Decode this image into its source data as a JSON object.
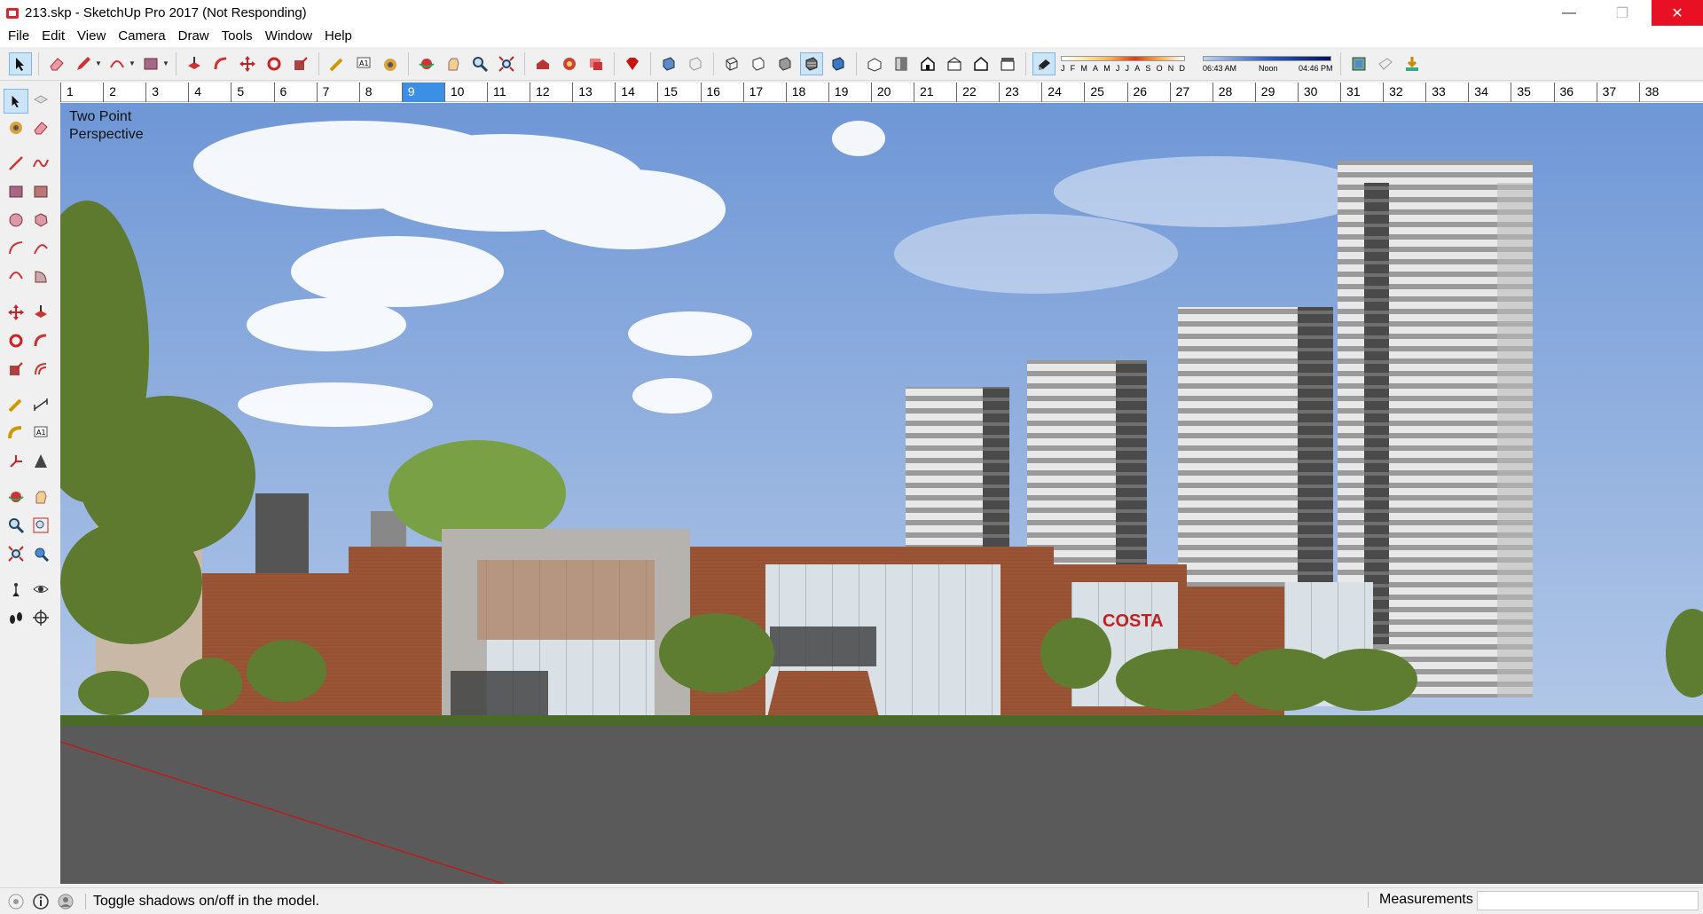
{
  "window": {
    "title": "213.skp - SketchUp Pro 2017 (Not Responding)"
  },
  "menu": [
    "File",
    "Edit",
    "View",
    "Camera",
    "Draw",
    "Tools",
    "Window",
    "Help"
  ],
  "shadow": {
    "months": [
      "J",
      "F",
      "M",
      "A",
      "M",
      "J",
      "J",
      "A",
      "S",
      "O",
      "N",
      "D"
    ],
    "time_start": "06:43 AM",
    "time_mid": "Noon",
    "time_end": "04:46 PM"
  },
  "ruler": {
    "labels": [
      "1",
      "2",
      "3",
      "4",
      "5",
      "6",
      "7",
      "8",
      "9",
      "10",
      "11",
      "12",
      "13",
      "14",
      "15",
      "16",
      "17",
      "18",
      "19",
      "20",
      "21",
      "22",
      "23",
      "24",
      "25",
      "26",
      "27",
      "28",
      "29",
      "30",
      "31",
      "32",
      "33",
      "34",
      "35",
      "36",
      "37",
      "38"
    ],
    "selected": "9"
  },
  "viewport": {
    "label_line1": "Two Point",
    "label_line2": "Perspective"
  },
  "status": {
    "text": "Toggle shadows on/off in the model.",
    "measurements_label": "Measurements",
    "measurements_value": ""
  },
  "colors": {
    "accent": "#3c8fe6",
    "close": "#e81123",
    "brick": "#9a5436",
    "sky": "#8fb0e0"
  },
  "icons": {
    "toolbar": [
      "select-icon",
      "eraser-icon",
      "pencil-icon",
      "arc-icon",
      "rectangle-icon",
      "push-pull-icon",
      "follow-me-icon",
      "move-icon",
      "rotate-icon",
      "scale-icon",
      "tape-measure-icon",
      "text-icon",
      "paint-bucket-icon",
      "orbit-icon",
      "pan-icon",
      "zoom-icon",
      "zoom-extents-icon",
      "warehouse-icon",
      "extension-warehouse-icon",
      "layout-icon",
      "ruby-icon",
      "xray-icon",
      "back-edges-icon",
      "wireframe-icon",
      "hidden-line-icon",
      "shaded-icon",
      "shaded-textures-icon",
      "monochrome-icon",
      "iso-icon",
      "top-view-icon",
      "front-view-icon",
      "right-view-icon",
      "back-view-icon",
      "left-view-icon",
      "shadows-icon",
      "geo-location-icon",
      "add-location-icon",
      "import-icon"
    ]
  }
}
